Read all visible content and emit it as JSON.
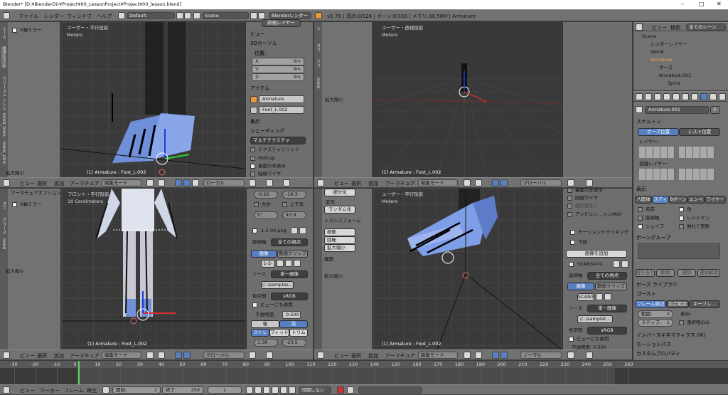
{
  "title_bar": {
    "title": "Blender* [D:¥BlenderDir¥Project¥00_LessonProject¥Project¥00_lesson.blend]",
    "min": "–",
    "max": "□",
    "close": "✕"
  },
  "info_header": {
    "menus": [
      "ファイル",
      "レンダー",
      "ウィンドウ",
      "ヘルプ"
    ],
    "layout": "Default",
    "scene": "Scene",
    "engine": "Blenderレンダー",
    "stats": "v2.79 | 頂点:0/126 | ボーン:0/103 | メモリ:38.58M | Armature"
  },
  "vp1": {
    "view": "ユーザー・平行投影",
    "units": "Meters",
    "obj": "(1) Armature : Foot_L.002"
  },
  "vp2": {
    "view": "ユーザー・透視投影",
    "units": "Meters",
    "obj": "(1) Armature : Foot_L.002"
  },
  "vp3": {
    "view": "フロント・平行投影",
    "units": "10 Centimeters",
    "obj": "(1) Armature : Foot_L.002"
  },
  "vp4": {
    "view": "ユーザー・平行投影",
    "units": "Meters",
    "obj": "(1) Armature : Foot_L.002"
  },
  "tool_tl": {
    "x_mirror": "X軸ミラー",
    "tabs": [
      "ツール",
      "オプション",
      "グリースペンシル",
      "mmd_tools",
      "mmd_utils"
    ],
    "scale": "拡大縮小"
  },
  "tool_bl": {
    "title": "アーマチュアオプション",
    "x_mirror": "X軸ミラー",
    "scale": "拡大縮小",
    "tabs": [
      "オプ",
      "グリース",
      "mmd"
    ]
  },
  "tool_tr": {
    "scale": "拡大縮小",
    "tabs": [
      "ツ",
      "オプ",
      "グリ",
      "mmd"
    ]
  },
  "tool_br": {
    "buttons": [
      "細分化",
      "ランダム化",
      "移動",
      "回転",
      "拡大縮小"
    ],
    "labels": {
      "deform": "変形:",
      "transform": "トランスフォーム",
      "history": "履歴"
    },
    "scale": "拡大縮小"
  },
  "npanel_tl": {
    "top_btn": "新規レイヤー",
    "view": "ビュー",
    "cursor": "3Dカーソル",
    "location": "位置:",
    "x": "X:",
    "y": "Y:",
    "z": "Z:",
    "xv": "0m",
    "yv": "0m",
    "zv": "0m",
    "item": "アイテム",
    "armature": "Armature",
    "bone": "Foot_L.002",
    "display": "表示",
    "shading": "シェーディング",
    "texture": "マルチテクスチャ",
    "opts": [
      "テクスチャソリッド",
      "Matcap",
      "裏面の非表示",
      "陰線ワイヤ"
    ]
  },
  "npanel_bl": {
    "vals": [
      "-0.26",
      "-16.3",
      "左右",
      "上下反",
      "0°",
      "43.9"
    ],
    "image_name": "1-2-04.png",
    "show": "全ての視点",
    "btn_image": "画像",
    "btn_clip": "動画クリップ",
    "img_short": "1-2-",
    "source_label": "ソース",
    "source": "単一画像",
    "path": "//..\\samples...",
    "colorspace_label": "色空間",
    "colorspace": "sRGB",
    "view_apply": "ビューにも適用",
    "opacity_label": "不透明度:",
    "opacity": "0.500",
    "back": "後",
    "front": "前",
    "stretch": "ストレ",
    "fit": "フィット",
    "crop": "トリム",
    "sx": "1.30",
    "sy": "-23.5"
  },
  "npanel_br": {
    "opts": [
      "裏面の非表示",
      "陰線ワイヤ",
      "面両面なし",
      "アンビエン...ョン(AO)"
    ],
    "motion": "モーショントラッキング",
    "bg": "下絵",
    "add_image": "画像を追加",
    "image_name": "SCAN3474...",
    "show": "全ての視点",
    "btn_image": "画像",
    "btn_clip": "動画クリップ",
    "img_short": "SCAN3",
    "source_label": "ソース",
    "source": "単一画像",
    "path": "//..\\samplet...",
    "colorspace_label": "色空間",
    "colorspace": "sRGB",
    "view_apply": "ビューにも適用",
    "opacity": "不透明度: 0.500"
  },
  "vh_tl": {
    "menus": [
      "ビュー",
      "選択",
      "追加",
      "アーマチュア"
    ],
    "mode": "編集モード",
    "orient": "ローカル"
  },
  "vh_tr": {
    "menus": [
      "ビュー",
      "選択",
      "追加",
      "アーマチュア"
    ],
    "mode": "編集モード",
    "orient": "グローバル"
  },
  "vh_bl": {
    "menus": [
      "ビュー",
      "選択",
      "追加",
      "アーマチュア"
    ],
    "mode": "編集モード",
    "orient": "グローバル"
  },
  "vh_br": {
    "menus": [
      "ビュー",
      "選択",
      "追加",
      "アーマチュア"
    ],
    "mode": "編集モード",
    "orient": "ノーマル"
  },
  "outliner": {
    "tabs": [
      "ビュー",
      "検索",
      "全てのシーン"
    ],
    "items": [
      "Scene",
      "レンダーレイヤー",
      "World",
      "Armature",
      "ポーズ",
      "Armature.001",
      "Spine"
    ]
  },
  "props": {
    "name": "Armature.001",
    "f": "F",
    "skeleton": "スケルトン",
    "pose_pos": "ポーズ位置",
    "rest_pos": "レスト位置",
    "layers": "レイヤー:",
    "protect": "保護レイヤー:",
    "display": "表示",
    "disp_types": [
      "八面体",
      "スティ",
      "Bボーン",
      "エンベ",
      "ワイヤー"
    ],
    "disp_opts": [
      "名前",
      "色",
      "座標軸",
      "レントゲン",
      "シェイプ",
      "遅れて更新"
    ],
    "bone_groups": "ボーングループ",
    "bg_btns": [
      "割り当て",
      "削除",
      "選択",
      "選択解除"
    ],
    "pose_lib": "ポーズ ライブラリ",
    "ghost": "ゴースト",
    "ghost_btns": [
      "フレーム周辺",
      "指定範囲",
      "キーフレ..."
    ],
    "range": "範囲:",
    "range_v": "0",
    "step": "ステップ:",
    "step_v": "1",
    "display2": "表示:",
    "selected_only": "選択物のみ",
    "ik": "インバースキネマティクス (IK)",
    "motion_path": "モーションパス",
    "custom_props": "カスタムプロパティ"
  },
  "timeline": {
    "ticks": [
      "-30",
      "-20",
      "-10",
      "0",
      "10",
      "20",
      "30",
      "40",
      "50",
      "60",
      "70",
      "80",
      "90",
      "100",
      "110",
      "120",
      "130",
      "140",
      "150",
      "160",
      "170",
      "180",
      "190",
      "200",
      "210",
      "220",
      "230",
      "240",
      "250",
      "260"
    ],
    "menus": [
      "ビュー",
      "マーカー",
      "フレーム",
      "再生"
    ],
    "start_label": "開始:",
    "start": "1",
    "end_label": "終了:",
    "end": "250",
    "current": "1",
    "sync": "同期しない"
  }
}
